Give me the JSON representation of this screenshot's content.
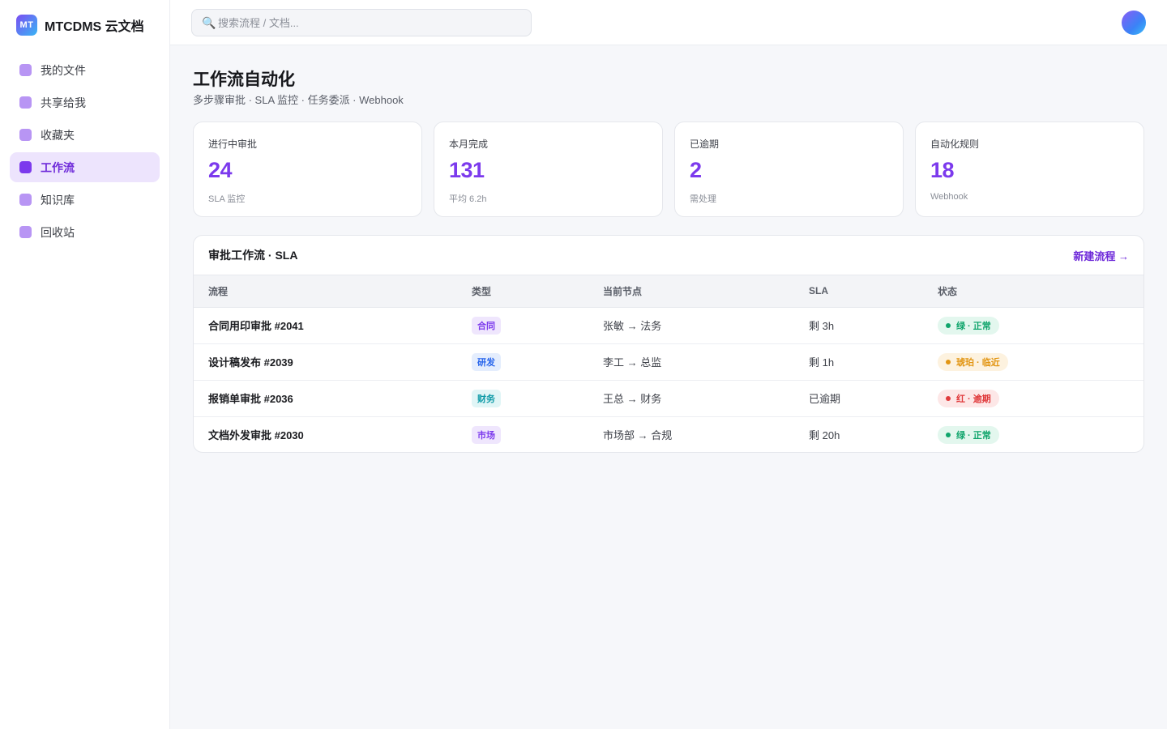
{
  "brand": {
    "logo": "MT",
    "name": "MTCDMS 云文档"
  },
  "sidebar": {
    "items": [
      {
        "label": "我的文件",
        "active": false
      },
      {
        "label": "共享给我",
        "active": false
      },
      {
        "label": "收藏夹",
        "active": false
      },
      {
        "label": "工作流",
        "active": true
      },
      {
        "label": "知识库",
        "active": false
      },
      {
        "label": "回收站",
        "active": false
      }
    ]
  },
  "search": {
    "icon": "search-icon",
    "placeholder": "搜索流程 / 文档..."
  },
  "page": {
    "title": "工作流自动化",
    "subtitle": "多步骤审批 · SLA 监控 · 任务委派 · Webhook"
  },
  "stats": [
    {
      "label": "进行中审批",
      "value": "24",
      "note": "SLA 监控"
    },
    {
      "label": "本月完成",
      "value": "131",
      "note": "平均 6.2h"
    },
    {
      "label": "已逾期",
      "value": "2",
      "note": "需处理"
    },
    {
      "label": "自动化规则",
      "value": "18",
      "note": "Webhook"
    }
  ],
  "panel": {
    "title": "审批工作流 · SLA",
    "link": "新建流程 →",
    "columns": [
      "流程",
      "类型",
      "当前节点",
      "SLA",
      "状态"
    ],
    "rows": [
      {
        "name": "合同用印审批 #2041",
        "type": "合同",
        "type_color": "#7c3aed",
        "type_bg": "#efe6fd",
        "node": "张敏 → 法务",
        "sla": "剩 3h",
        "status": "绿 · 正常",
        "status_color": "#10a56c",
        "status_bg": "#e3f7ee"
      },
      {
        "name": "设计稿发布 #2039",
        "type": "研发",
        "type_color": "#2563eb",
        "type_bg": "#e4edfd",
        "node": "李工 → 总监",
        "sla": "剩 1h",
        "status": "琥珀 · 临近",
        "status_color": "#e29512",
        "status_bg": "#fdf2df"
      },
      {
        "name": "报销单审批 #2036",
        "type": "财务",
        "type_color": "#0e9aa7",
        "type_bg": "#e0f5f6",
        "node": "王总 → 财务",
        "sla": "已逾期",
        "status": "红 · 逾期",
        "status_color": "#e0393b",
        "status_bg": "#fde7e7"
      },
      {
        "name": "文档外发审批 #2030",
        "type": "市场",
        "type_color": "#7c3aed",
        "type_bg": "#efe6fd",
        "node": "市场部 → 合规",
        "sla": "剩 20h",
        "status": "绿 · 正常",
        "status_color": "#10a56c",
        "status_bg": "#e3f7ee"
      }
    ]
  }
}
